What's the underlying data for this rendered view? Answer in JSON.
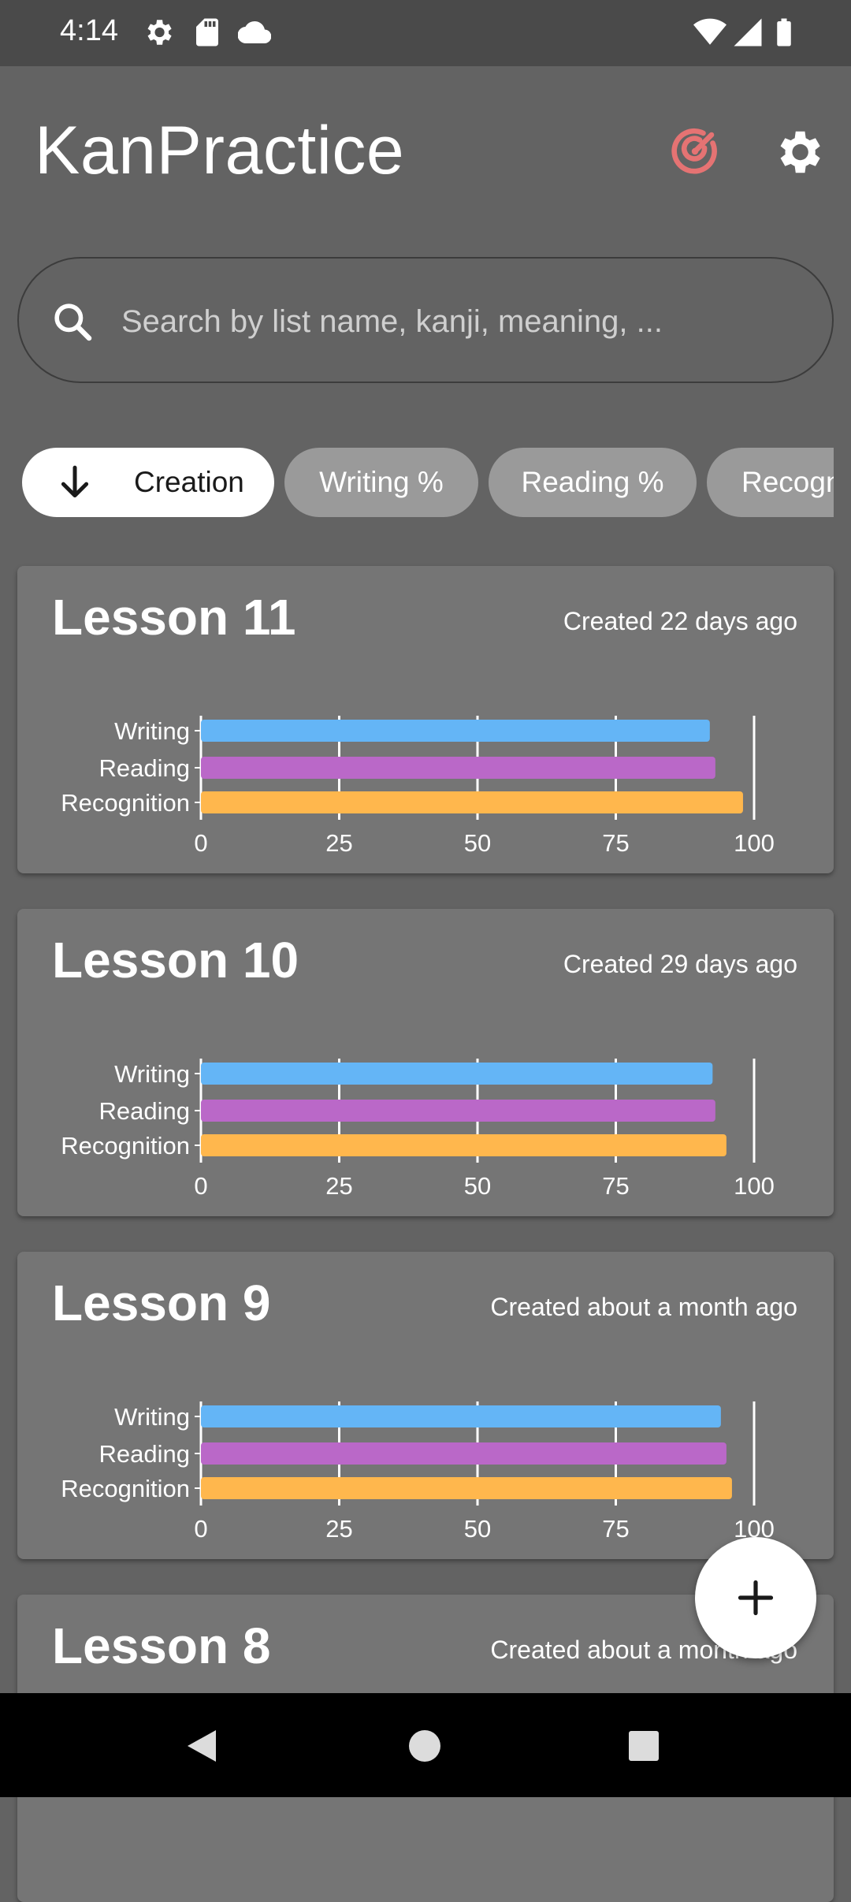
{
  "status_bar": {
    "time": "4:14",
    "icons_left": [
      "gear-icon",
      "sd-card-icon",
      "cloud-icon"
    ],
    "icons_right": [
      "wifi-icon",
      "signal-icon",
      "battery-icon"
    ]
  },
  "app": {
    "title": "KanPractice",
    "accent_color": "#E57373",
    "icons": [
      "target-icon",
      "settings-icon"
    ]
  },
  "search": {
    "placeholder": "Search by list name, kanji, meaning, ...",
    "value": ""
  },
  "sort_chips": [
    {
      "label": "Creation",
      "active": true,
      "icon": "arrow-down-icon"
    },
    {
      "label": "Writing %",
      "active": false
    },
    {
      "label": "Reading %",
      "active": false
    },
    {
      "label": "Recogn",
      "active": false
    }
  ],
  "colors": {
    "writing": "#64B5F6",
    "reading": "#BA68C8",
    "recognition": "#FFB74D"
  },
  "lessons": [
    {
      "title": "Lesson 11",
      "created": "Created 22 days ago"
    },
    {
      "title": "Lesson 10",
      "created": "Created 29 days ago"
    },
    {
      "title": "Lesson 9",
      "created": "Created about a month ago"
    },
    {
      "title": "Lesson 8",
      "created": "Created about a month ago"
    }
  ],
  "chart_data": [
    {
      "type": "bar",
      "orientation": "horizontal",
      "categories": [
        "Writing",
        "Reading",
        "Recognition"
      ],
      "values": [
        92,
        93,
        98
      ],
      "xlim": [
        0,
        100
      ],
      "ticks": [
        0,
        25,
        50,
        75,
        100
      ],
      "grid": true
    },
    {
      "type": "bar",
      "orientation": "horizontal",
      "categories": [
        "Writing",
        "Reading",
        "Recognition"
      ],
      "values": [
        92.5,
        93,
        95
      ],
      "xlim": [
        0,
        100
      ],
      "ticks": [
        0,
        25,
        50,
        75,
        100
      ],
      "grid": true
    },
    {
      "type": "bar",
      "orientation": "horizontal",
      "categories": [
        "Writing",
        "Reading",
        "Recognition"
      ],
      "values": [
        94,
        95,
        96
      ],
      "xlim": [
        0,
        100
      ],
      "ticks": [
        0,
        25,
        50,
        75,
        100
      ],
      "grid": true
    }
  ],
  "fab": {
    "icon": "plus-icon"
  },
  "nav_bar": {
    "icons": [
      "back-icon",
      "home-icon",
      "recents-icon"
    ]
  }
}
